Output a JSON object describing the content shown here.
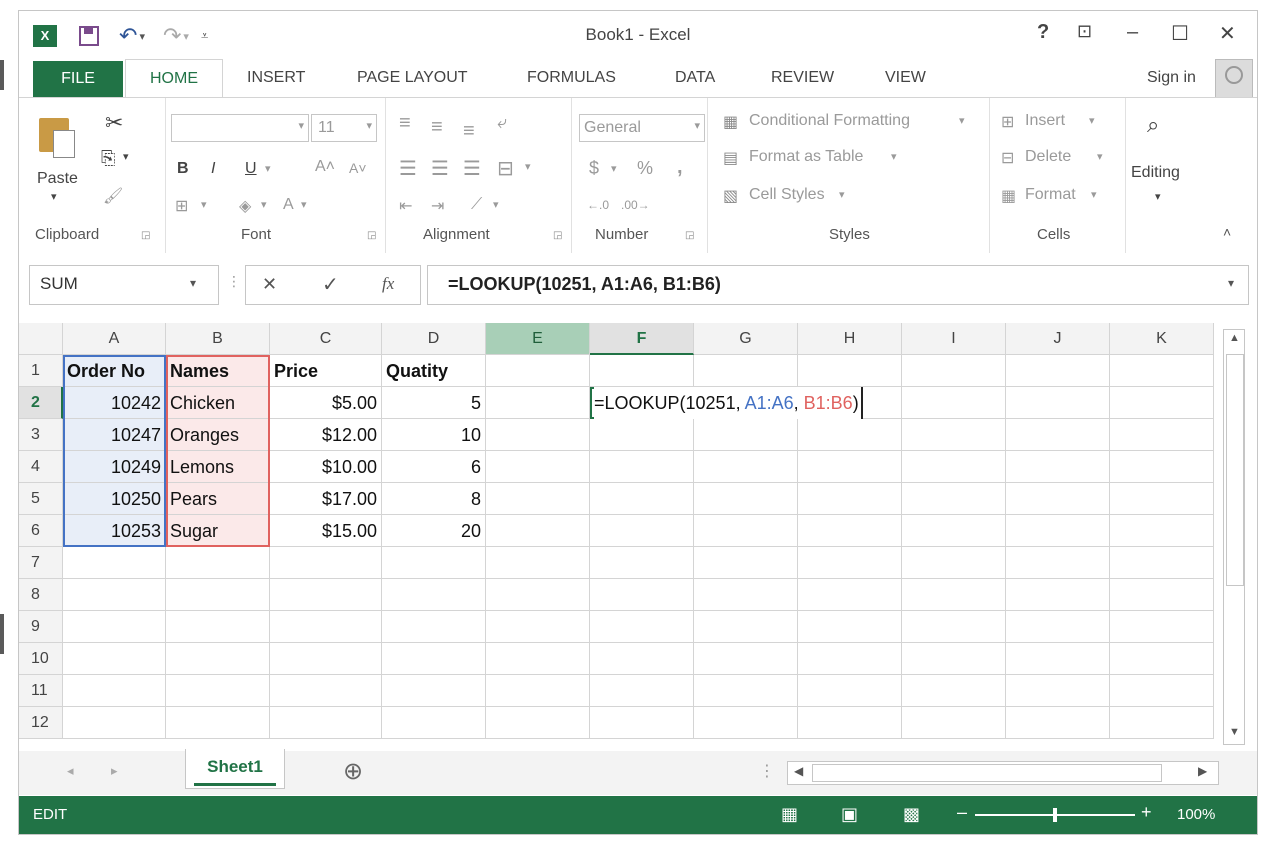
{
  "window": {
    "title": "Book1 - Excel",
    "help": "?",
    "restore_ribbon": "⊡",
    "minimize": "–",
    "maximize": "☐",
    "close": "✕"
  },
  "ribbon_tabs": {
    "file": "FILE",
    "home": "HOME",
    "insert": "INSERT",
    "page_layout": "PAGE LAYOUT",
    "formulas": "FORMULAS",
    "data": "DATA",
    "review": "REVIEW",
    "view": "VIEW",
    "sign_in": "Sign in"
  },
  "ribbon": {
    "clipboard": {
      "label": "Clipboard",
      "paste": "Paste"
    },
    "font": {
      "label": "Font",
      "font_name": "",
      "font_size": "11",
      "bold": "B",
      "italic": "I",
      "underline": "U",
      "grow": "A˄",
      "shrink": "A˅",
      "font_color": "A"
    },
    "alignment": {
      "label": "Alignment"
    },
    "number": {
      "label": "Number",
      "format": "General",
      "currency": "$",
      "percent": "%",
      "comma": ","
    },
    "styles": {
      "label": "Styles",
      "conditional": "Conditional Formatting",
      "format_table": "Format as Table",
      "cell_styles": "Cell Styles"
    },
    "cells": {
      "label": "Cells",
      "insert": "Insert",
      "delete": "Delete",
      "format": "Format"
    },
    "editing": {
      "label": "Editing"
    }
  },
  "formula_bar": {
    "name_box": "SUM",
    "cancel": "✕",
    "enter": "✓",
    "fx": "fx",
    "formula": "=LOOKUP(10251, A1:A6, B1:B6)"
  },
  "columns": [
    "A",
    "B",
    "C",
    "D",
    "E",
    "F",
    "G",
    "H",
    "I",
    "J",
    "K"
  ],
  "rows": [
    "1",
    "2",
    "3",
    "4",
    "5",
    "6",
    "7",
    "8",
    "9",
    "10",
    "11",
    "12"
  ],
  "headers": [
    "Order No",
    "Names",
    "Price",
    "Quatity"
  ],
  "data_rows": [
    [
      "10242",
      "Chicken",
      "$5.00",
      "5"
    ],
    [
      "10247",
      "Oranges",
      "$12.00",
      "10"
    ],
    [
      "10249",
      "Lemons",
      "$10.00",
      "6"
    ],
    [
      "10250",
      "Pears",
      "$17.00",
      "8"
    ],
    [
      "10253",
      "Sugar",
      "$15.00",
      "20"
    ]
  ],
  "editing_cell": {
    "prefix": "=LOOKUP(10251, ",
    "ref1": "A1:A6",
    "sep": ", ",
    "ref2": "B1:B6",
    "suffix": ")"
  },
  "sheets": {
    "active": "Sheet1",
    "add": "⊕"
  },
  "status": {
    "mode": "EDIT",
    "zoom": "100%"
  },
  "colors": {
    "excel_green": "#217346",
    "ref1_color": "#4472c4",
    "ref2_color": "#e0625f"
  }
}
